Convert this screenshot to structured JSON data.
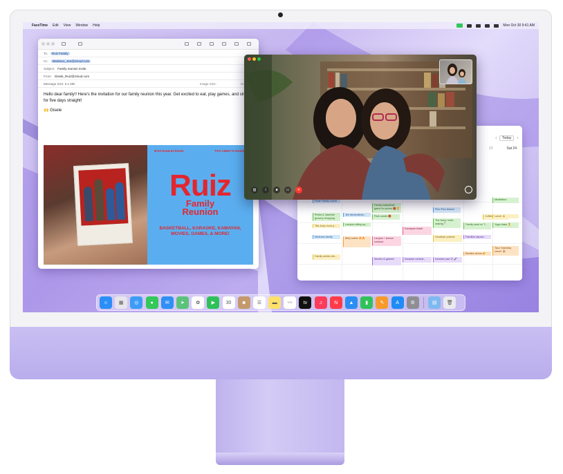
{
  "menubar": {
    "apple": "",
    "app_name": "FaceTime",
    "items": [
      "Edit",
      "View",
      "Window",
      "Help"
    ],
    "datetime": "Mon Oct 30  9:41 AM"
  },
  "mail": {
    "to_label": "To:",
    "to_value": "Ruiz Family",
    "cc_label": "Cc:",
    "cc_value": "Medrano_Jen@icloud.com",
    "subject_label": "Subject:",
    "subject_value": "Family reunion invite",
    "from_label": "From:",
    "from_value": "Gisele_Ruiz@icloud.com",
    "size_label": "Message Size: 6.1 MB",
    "image_size_label": "Image Size:",
    "image_size_value": "Actual Size",
    "body": "Hello dear family!! Here's the invitation for our family reunion this year. Get excited to eat, play games, and sing for five days straight!",
    "signoff": "🙌 Gisele",
    "poster": {
      "address": "8723 KUULEI ROAD",
      "host": "TITA CINDY'S HOUSE",
      "title": "Ruiz",
      "subtitle_1": "Family",
      "subtitle_2": "Reunion",
      "activities": "BASKETBALL, KARAOKE, KAMAYAN, MOVIES, GAMES, & MORE!"
    }
  },
  "calendar": {
    "today_label": "Today",
    "day_num": "23",
    "day_label": "Sat 24",
    "events": [
      {
        "text": "Float Family Lunch",
        "color": "blue"
      },
      {
        "text": "Family basketball game for prizes 🏀🏆",
        "color": "green"
      },
      {
        "text": "Pedro & Jasmine grocery shopping",
        "color": "green"
      },
      {
        "text": "Jen decorations...",
        "color": "blue"
      },
      {
        "text": "Park courts 🏀",
        "color": "green"
      },
      {
        "text": "Pico Pico lesson",
        "color": "blue"
      },
      {
        "text": "Coffee tasting ☕",
        "color": "yellow"
      },
      {
        "text": "Tita Judy: food p...",
        "color": "yellow"
      },
      {
        "text": "Lumpia rolling sq...",
        "color": "green"
      },
      {
        "text": "The Navy: knife-making 🔪",
        "color": "green"
      },
      {
        "text": "Family work w/ T...",
        "color": "green"
      },
      {
        "text": "Yoga class 🧘",
        "color": "green"
      },
      {
        "text": "Kamayan feast!",
        "color": "pink"
      },
      {
        "text": "Goodbye potluck",
        "color": "yellow"
      },
      {
        "text": "Families depart...",
        "color": "purple"
      },
      {
        "text": "Lumpia + lechon cookout",
        "color": "pink"
      },
      {
        "text": "Medrano family arrive",
        "color": "blue"
      },
      {
        "text": "BBQ buffet 🔥🔥",
        "color": "orange"
      },
      {
        "text": "Beetles dinner 🌮",
        "color": "orange"
      },
      {
        "text": "Taco Saturday cheer! 🎉",
        "color": "orange"
      },
      {
        "text": "Family adobo din...",
        "color": "yellow"
      },
      {
        "text": "Movies & games!",
        "color": "purple"
      },
      {
        "text": "Karaoke contest...",
        "color": "purple"
      },
      {
        "text": "Karaoke part 2! 🎤",
        "color": "purple"
      },
      {
        "text": "Lunch 🍝",
        "color": "yellow"
      },
      {
        "text": "Meditation",
        "color": "green"
      }
    ]
  },
  "facetime": {
    "controls": [
      "sidebar",
      "info",
      "camera",
      "screen",
      "end-call"
    ]
  },
  "dock": {
    "apps": [
      {
        "name": "finder-icon",
        "color": "#2c8ef8",
        "glyph": "☺"
      },
      {
        "name": "launchpad-icon",
        "color": "#e6e6ea",
        "glyph": "▦"
      },
      {
        "name": "safari-icon",
        "color": "#3d9cf5",
        "glyph": "◎"
      },
      {
        "name": "messages-icon",
        "color": "#34c759",
        "glyph": "●"
      },
      {
        "name": "mail-icon",
        "color": "#2f8ff5",
        "glyph": "✉"
      },
      {
        "name": "maps-icon",
        "color": "#5bc27a",
        "glyph": "➤"
      },
      {
        "name": "photos-icon",
        "color": "#ffffff",
        "glyph": "✿"
      },
      {
        "name": "facetime-icon",
        "color": "#2fc159",
        "glyph": "▶"
      },
      {
        "name": "calendar-icon",
        "color": "#ffffff",
        "glyph": "30"
      },
      {
        "name": "contacts-icon",
        "color": "#c49a6c",
        "glyph": "☻"
      },
      {
        "name": "reminders-icon",
        "color": "#ffffff",
        "glyph": "☰"
      },
      {
        "name": "notes-icon",
        "color": "#fde16a",
        "glyph": "▬"
      },
      {
        "name": "freeform-icon",
        "color": "#ffffff",
        "glyph": "〰"
      },
      {
        "name": "apple-tv-icon",
        "color": "#111111",
        "glyph": "tv"
      },
      {
        "name": "music-icon",
        "color": "#fb3c5a",
        "glyph": "♫"
      },
      {
        "name": "news-icon",
        "color": "#ff3b4a",
        "glyph": "N"
      },
      {
        "name": "keynote-icon",
        "color": "#2a8ef2",
        "glyph": "▲"
      },
      {
        "name": "numbers-icon",
        "color": "#30c25a",
        "glyph": "▮"
      },
      {
        "name": "pages-icon",
        "color": "#f79a2c",
        "glyph": "✎"
      },
      {
        "name": "app-store-icon",
        "color": "#1f8cf5",
        "glyph": "A"
      },
      {
        "name": "system-settings-icon",
        "color": "#8e8e93",
        "glyph": "⚙"
      }
    ],
    "folder": {
      "name": "downloads-folder-icon",
      "color": "#7fb9f0",
      "glyph": "▤"
    },
    "trash": {
      "name": "trash-icon",
      "color": "#e9e9ee",
      "glyph": "🗑"
    }
  }
}
